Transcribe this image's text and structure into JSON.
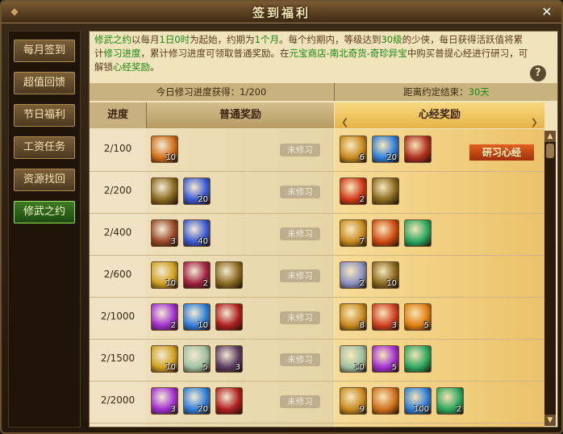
{
  "window": {
    "title": "签到福利",
    "close_symbol": "✕"
  },
  "sidebar": {
    "items": [
      {
        "label": "每月签到",
        "active": false
      },
      {
        "label": "超值回馈",
        "active": false
      },
      {
        "label": "节日福利",
        "active": false
      },
      {
        "label": "工资任务",
        "active": false
      },
      {
        "label": "资源找回",
        "active": false
      },
      {
        "label": "修武之约",
        "active": true
      }
    ]
  },
  "description": {
    "p1": "修武之约",
    "p2": "以每月",
    "p3": "1日0时",
    "p4": "为起始，约期为",
    "p5": "1个月",
    "p6": "。每个约期内，等级达到",
    "p7": "30级",
    "p8": "的少侠，每日获得活跃值将累计",
    "p9": "修习进度",
    "p10": "，累计修习进度可领取普通奖励。在",
    "p11": "元宝商店-南北奇货-奇珍异宝",
    "p12": "中购买普提心经进行研习，可解锁",
    "p13": "心经奖励",
    "p14": "。"
  },
  "help_icon": "?",
  "status": {
    "left": "今日修习进度获得：1/200",
    "right_prefix": "距离约定结束：",
    "right_value": "30天"
  },
  "columns": {
    "progress": "进度",
    "normal": "普通奖励",
    "sutra": "心经奖励"
  },
  "unstudied_label": "未修习",
  "study_button": "研习心经",
  "rows": [
    {
      "progress": "2/100",
      "normal": [
        {
          "icon": "fire-item-icon",
          "count": "10",
          "color": "#d0701a"
        }
      ],
      "sutra": [
        {
          "icon": "gold-coin-icon",
          "count": "6",
          "color": "#c88a20"
        },
        {
          "icon": "blue-crystal-icon",
          "count": "20",
          "color": "#2f7ed8"
        },
        {
          "icon": "scroll-item-icon",
          "count": "",
          "color": "#b03020"
        }
      ]
    },
    {
      "progress": "2/200",
      "normal": [
        {
          "icon": "gold-token-icon",
          "count": "",
          "color": "#8a6a20"
        },
        {
          "icon": "blue-orb-icon",
          "count": "20",
          "color": "#3a5ad0"
        }
      ],
      "sutra": [
        {
          "icon": "red-orb-icon",
          "count": "2",
          "color": "#d03818"
        },
        {
          "icon": "gold-token-icon",
          "count": "",
          "color": "#8a6a20"
        }
      ]
    },
    {
      "progress": "2/400",
      "normal": [
        {
          "icon": "box-item-icon",
          "count": "3",
          "color": "#9a4a2a"
        },
        {
          "icon": "blue-orb-icon",
          "count": "40",
          "color": "#3a5ad0"
        }
      ],
      "sutra": [
        {
          "icon": "gold-coin-icon",
          "count": "7",
          "color": "#c88a20"
        },
        {
          "icon": "fire-sword-icon",
          "count": "",
          "color": "#d04a10"
        },
        {
          "icon": "jade-item-icon",
          "count": "",
          "color": "#2aa860"
        }
      ]
    },
    {
      "progress": "2/600",
      "normal": [
        {
          "icon": "gold-ingot-icon",
          "count": "10",
          "color": "#d0a020"
        },
        {
          "icon": "red-orb-icon",
          "count": "2",
          "color": "#a02040"
        },
        {
          "icon": "gold-token-icon",
          "count": "",
          "color": "#8a6a20"
        }
      ],
      "sutra": [
        {
          "icon": "silver-crystal-icon",
          "count": "2",
          "color": "#8a90c0"
        },
        {
          "icon": "gold-token-icon",
          "count": "10",
          "color": "#8a6a20"
        }
      ]
    },
    {
      "progress": "2/1000",
      "normal": [
        {
          "icon": "purple-gem-icon",
          "count": "2",
          "color": "#a030d0"
        },
        {
          "icon": "blue-crystal-icon",
          "count": "10",
          "color": "#2f7ed8"
        },
        {
          "icon": "red-armor-icon",
          "count": "",
          "color": "#b02020"
        }
      ],
      "sutra": [
        {
          "icon": "gold-coin-icon",
          "count": "8",
          "color": "#c88a20"
        },
        {
          "icon": "red-scroll-icon",
          "count": "3",
          "color": "#d04020"
        },
        {
          "icon": "spark-item-icon",
          "count": "5",
          "color": "#e08010"
        }
      ]
    },
    {
      "progress": "2/1500",
      "normal": [
        {
          "icon": "gold-ingot-icon",
          "count": "10",
          "color": "#d0a020"
        },
        {
          "icon": "white-gem-icon",
          "count": "5",
          "color": "#a0c0a0"
        },
        {
          "icon": "dark-crystal-icon",
          "count": "3",
          "color": "#5a3a60"
        }
      ],
      "sutra": [
        {
          "icon": "white-gem-icon",
          "count": "10",
          "color": "#a0c0a0"
        },
        {
          "icon": "purple-gem-icon",
          "count": "5",
          "color": "#a030d0"
        },
        {
          "icon": "jade-item-icon",
          "count": "",
          "color": "#2aa860"
        }
      ]
    },
    {
      "progress": "2/2000",
      "normal": [
        {
          "icon": "purple-gem-icon",
          "count": "3",
          "color": "#a030d0"
        },
        {
          "icon": "blue-crystal-icon",
          "count": "20",
          "color": "#2f7ed8"
        },
        {
          "icon": "red-armor-icon",
          "count": "",
          "color": "#b02020"
        }
      ],
      "sutra": [
        {
          "icon": "gold-coin-icon",
          "count": "9",
          "color": "#c88a20"
        },
        {
          "icon": "fire-item-icon",
          "count": "",
          "color": "#d0701a"
        },
        {
          "icon": "blue-crystal-icon",
          "count": "100",
          "color": "#2f7ed8"
        },
        {
          "icon": "jade-item-icon",
          "count": "2",
          "color": "#2aa860"
        }
      ]
    }
  ],
  "scrollbar": {
    "up_symbol": "▲",
    "down_symbol": "▼"
  }
}
